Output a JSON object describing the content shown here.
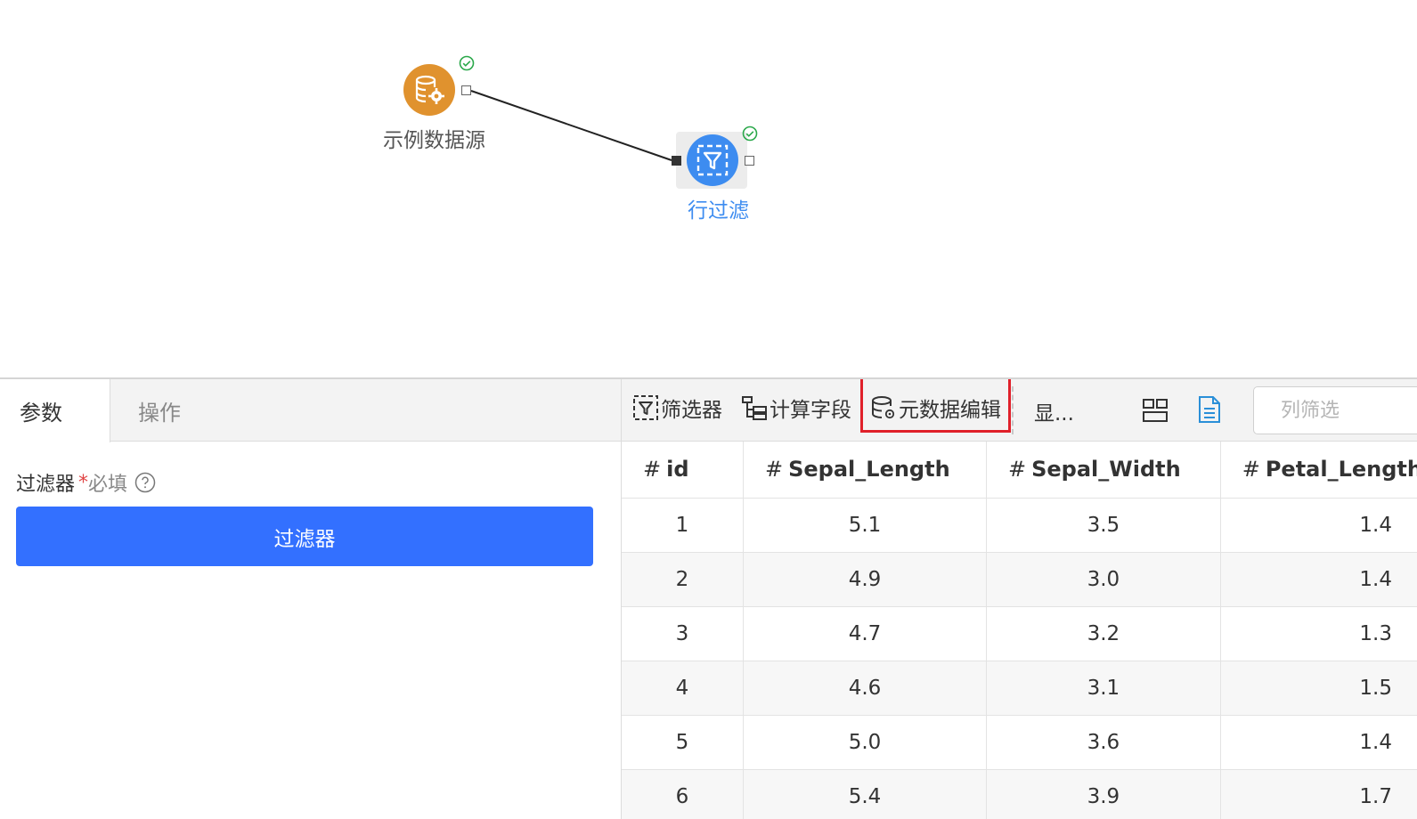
{
  "canvas": {
    "nodes": [
      {
        "id": "source",
        "label": "示例数据源",
        "icon": "database-gear-icon",
        "color": "#e0922e",
        "status": "success"
      },
      {
        "id": "rowfilter",
        "label": "行过滤",
        "icon": "filter-icon",
        "color": "#3d8cf0",
        "status": "success"
      }
    ]
  },
  "left_panel": {
    "tabs": [
      {
        "label": "参数",
        "active": true
      },
      {
        "label": "操作",
        "active": false
      }
    ],
    "field_label": "过滤器",
    "required_mark": "*",
    "required_text": "必填",
    "filter_button_label": "过滤器"
  },
  "right_panel": {
    "toolbar": {
      "filter_label": "筛选器",
      "calc_field_label": "计算字段",
      "meta_edit_label": "元数据编辑",
      "display_label": "显...",
      "column_filter_placeholder": "列筛选"
    },
    "table": {
      "columns": [
        {
          "type_icon": "#",
          "name": "id"
        },
        {
          "type_icon": "#",
          "name": "Sepal_Length"
        },
        {
          "type_icon": "#",
          "name": "Sepal_Width"
        },
        {
          "type_icon": "#",
          "name": "Petal_Length"
        }
      ],
      "rows": [
        [
          "1",
          "5.1",
          "3.5",
          "1.4"
        ],
        [
          "2",
          "4.9",
          "3.0",
          "1.4"
        ],
        [
          "3",
          "4.7",
          "3.2",
          "1.3"
        ],
        [
          "4",
          "4.6",
          "3.1",
          "1.5"
        ],
        [
          "5",
          "5.0",
          "3.6",
          "1.4"
        ],
        [
          "6",
          "5.4",
          "3.9",
          "1.7"
        ]
      ]
    }
  },
  "colors": {
    "primary_button": "#3370ff",
    "highlight_box": "#e0202a",
    "success": "#2aa84a",
    "source_node": "#e0922e",
    "filter_node": "#3d8cf0"
  }
}
